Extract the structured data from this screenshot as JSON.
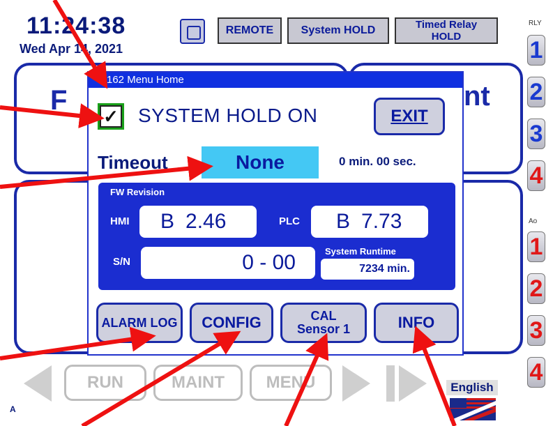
{
  "status_bar": {
    "time": "11:24:38",
    "date": "Wed  Apr 14, 2021",
    "remote_label": "REMOTE",
    "system_hold_label": "System HOLD",
    "timed_relay_label": "Timed Relay HOLD"
  },
  "right_rail": {
    "relay_header": "RLY",
    "relays": [
      "1",
      "2",
      "3",
      "4"
    ],
    "analog_header": "Ao",
    "analog_outputs": [
      "1",
      "2",
      "3",
      "4"
    ]
  },
  "background_screen": {
    "left_fragment": "F",
    "right_fragment": "nt",
    "corner_letter": "A"
  },
  "bottom_bar": {
    "run_label": "RUN",
    "maint_label": "MAINT",
    "menu_label": "MENU",
    "language": "English"
  },
  "dialog": {
    "title": "162  Menu Home",
    "hold_checked": true,
    "hold_label": "SYSTEM HOLD ON",
    "exit_label": "EXIT",
    "timeout_label": "Timeout",
    "timeout_value": "None",
    "timeout_min": "0",
    "timeout_min_unit": "min.",
    "timeout_sec": "00",
    "timeout_sec_unit": "sec.",
    "fw_revision_label": "FW Revision",
    "hmi_label": "HMI",
    "hmi_rev_letter": "B",
    "hmi_rev": "2.46",
    "plc_label": "PLC",
    "plc_rev_letter": "B",
    "plc_rev": "7.73",
    "sn_label": "S/N",
    "sn_value": "0 - 00",
    "runtime_label": "System Runtime",
    "runtime_value": "7234 min.",
    "buttons": {
      "alarm_log": "ALARM LOG",
      "config": "CONFIG",
      "cal": "CAL Sensor 1",
      "info": "INFO"
    }
  },
  "colors": {
    "annotation_arrow": "#ee1111",
    "accent_blue": "#1a2aa8",
    "timeout_highlight": "#44c8f4",
    "check_border": "#1aa01a"
  }
}
